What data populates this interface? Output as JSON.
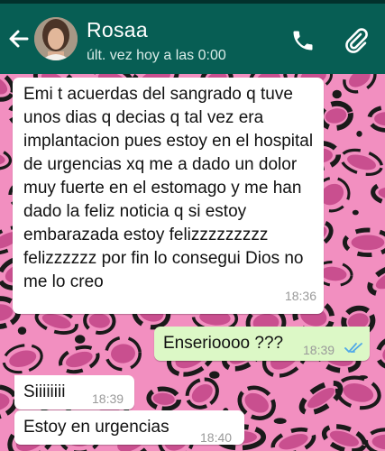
{
  "header": {
    "contact_name": "Rosaa",
    "last_seen": "últ. vez hoy a las 0:00",
    "back_icon": "arrow-left-icon",
    "call_icon": "phone-icon",
    "attach_icon": "paperclip-icon",
    "bar_color": "#075e54"
  },
  "wallpaper": {
    "style": "pink leopard print",
    "base_color": "#f28fc0",
    "spot_color": "#1a1a1a",
    "inner_color": "#c94f8f"
  },
  "messages": [
    {
      "direction": "incoming",
      "text": "Emi t acuerdas del sangrado q tuve unos dias q decias q tal vez era implantacion pues estoy en el hospital de urgencias xq me a dado un dolor muy fuerte en el estomago y me han dado la feliz noticia q si estoy embarazada estoy felizzzzzzzzz felizzzzzz por fin lo consegui Dios no me lo creo",
      "time": "18:36"
    },
    {
      "direction": "outgoing",
      "text": "Enserioooo ???",
      "time": "18:39",
      "status_icon": "double-check-read-icon"
    },
    {
      "direction": "incoming",
      "text": "Siiiiiiii",
      "time": "18:39"
    },
    {
      "direction": "incoming",
      "text": "Estoy en urgencias",
      "time": "18:40"
    }
  ]
}
